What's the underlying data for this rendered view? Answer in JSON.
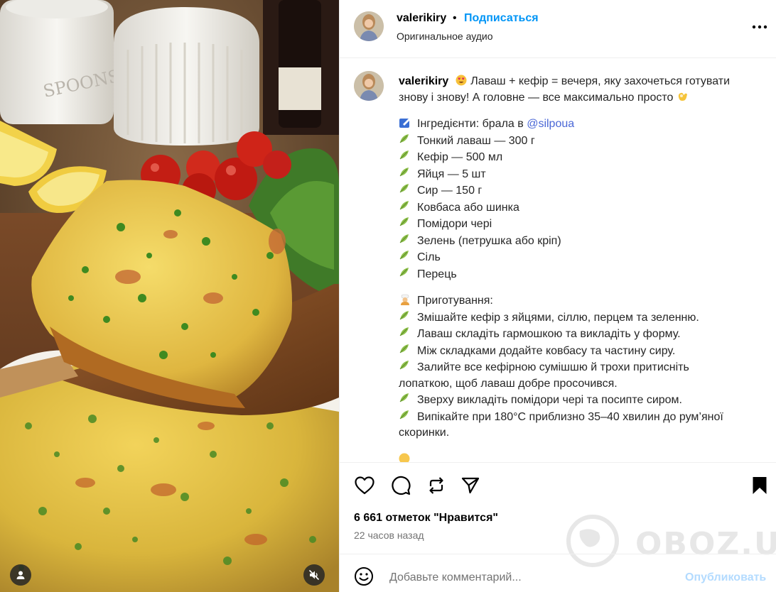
{
  "media": {
    "jar_label": "SPOONS",
    "user_icon": "user-tag-icon",
    "mute_icon": "speaker-muted-icon"
  },
  "header": {
    "username": "valerikiry",
    "separator": "•",
    "follow_label": "Подписаться",
    "audio_label": "Оригинальное аудио",
    "more_icon": "more-horizontal-icon"
  },
  "caption": {
    "username": "valerikiry",
    "intro_line1": " Лаваш + кефір = вечеря, яку захочеться готувати",
    "intro_line2": "знову і знову! А головне — все максимально просто ",
    "ingredients_title": "Інгредієнти: брала в ",
    "mention": "@silpoua",
    "ingredients": [
      "Тонкий лаваш — 300 г",
      "Кефір — 500 мл",
      "Яйця — 5 шт",
      "Сир — 150 г",
      "Ковбаса або шинка",
      "Помідори чері",
      "Зелень (петрушка або кріп)",
      "Сіль",
      "Перець"
    ],
    "steps_title": "Приготування:",
    "steps": [
      "Змішайте кефір з яйцями, сіллю, перцем та зеленню.",
      "Лаваш складіть гармошкою та викладіть у форму.",
      "Між складками додайте ковбасу та частину сиру.",
      "Залийте все кефірною сумішшю й трохи притисніть",
      "лопаткою, щоб лаваш добре просочився.",
      "Зверху викладіть помідори чері та посипте сиром.",
      "Випікайте при 180°C приблизно 35–40 хвилин до рум’яної",
      "скоринки."
    ],
    "step_has_bullet": [
      true,
      true,
      true,
      true,
      false,
      true,
      true,
      false
    ]
  },
  "actions": {
    "like_icon": "heart-icon",
    "comment_icon": "comment-icon",
    "repost_icon": "repost-icon",
    "share_icon": "send-icon",
    "save_icon": "bookmark-icon"
  },
  "likes_text": "6 661 отметок \"Нравится\"",
  "time_text": "22 часов назад",
  "comment": {
    "placeholder": "Добавьте комментарий...",
    "post_label": "Опубликовать",
    "emoji_icon": "smiley-icon"
  },
  "watermark": {
    "text": "OBOZ.UA"
  },
  "colors": {
    "accent": "#0095f6",
    "post_disabled": "#b3dbff",
    "mention": "#4a67d6",
    "secondary_text": "#737373"
  }
}
